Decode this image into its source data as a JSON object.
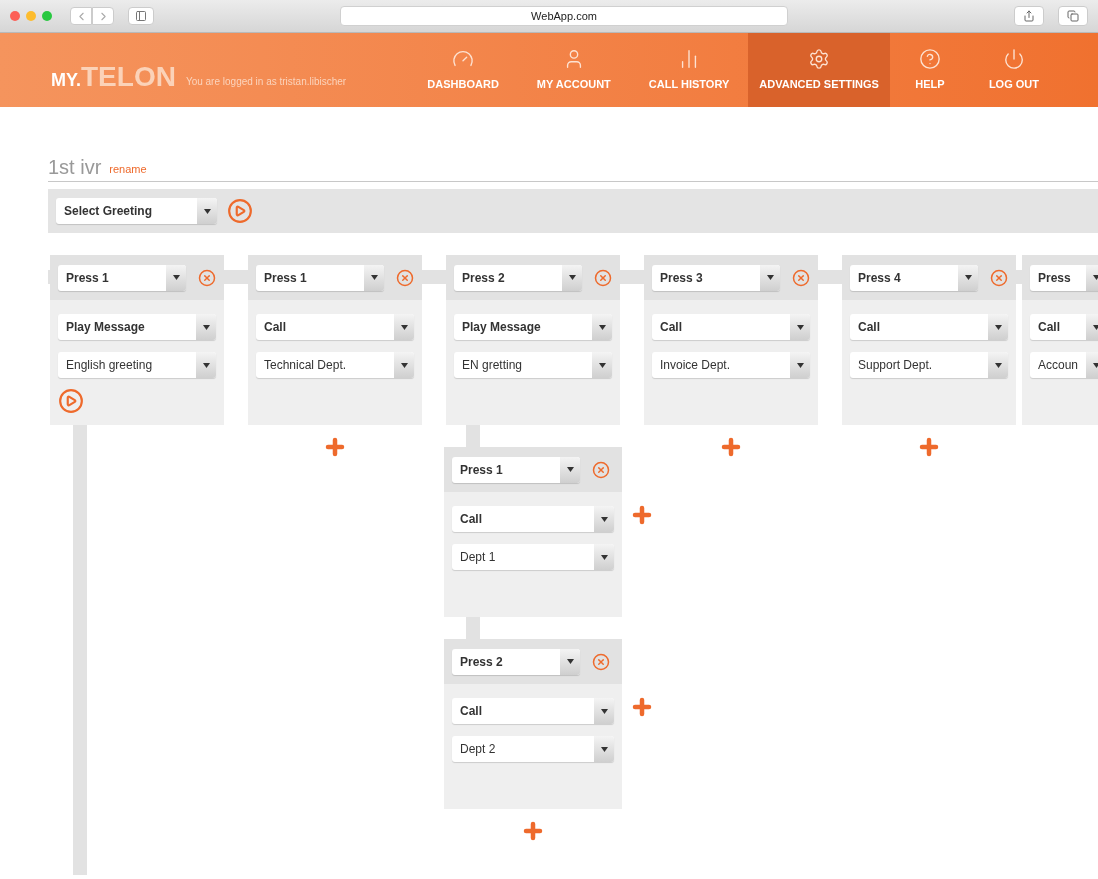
{
  "browser": {
    "url": "WebApp.com"
  },
  "header": {
    "logo_prefix": "MY.",
    "logo": "TELON",
    "login_text": "You are logged in as tristan.libischer",
    "nav": [
      {
        "label": "DASHBOARD",
        "selected": false
      },
      {
        "label": "MY ACCOUNT",
        "selected": false
      },
      {
        "label": "CALL HISTORY",
        "selected": false
      },
      {
        "label": "ADVANCED SETTINGS",
        "selected": true
      },
      {
        "label": "HELP",
        "selected": false
      },
      {
        "label": "LOG OUT",
        "selected": false
      }
    ]
  },
  "ivr": {
    "name": "1st ivr",
    "rename": "rename",
    "greeting": "Select Greeting"
  },
  "branches": [
    {
      "key": "Press 1",
      "action": "Play Message",
      "target": "English greeting",
      "play": true,
      "removable": true,
      "add": false
    },
    {
      "key": "Press 1",
      "action": "Call",
      "target": "Technical Dept.",
      "play": false,
      "removable": true,
      "add": true
    },
    {
      "key": "Press 2",
      "action": "Play Message",
      "target": "EN gretting",
      "play": false,
      "removable": true,
      "add": true,
      "children": [
        {
          "key": "Press 1",
          "action": "Call",
          "target": "Dept 1",
          "removable": true,
          "add": true
        },
        {
          "key": "Press 2",
          "action": "Call",
          "target": "Dept 2",
          "removable": true,
          "add": true
        }
      ]
    },
    {
      "key": "Press 3",
      "action": "Call",
      "target": "Invoice Dept.",
      "play": false,
      "removable": true,
      "add": true
    },
    {
      "key": "Press 4",
      "action": "Call",
      "target": "Support Dept.",
      "play": false,
      "removable": true,
      "add": true
    },
    {
      "key": "Press",
      "action": "Call",
      "target": "Accoun",
      "play": false,
      "removable": false,
      "add": false
    }
  ]
}
